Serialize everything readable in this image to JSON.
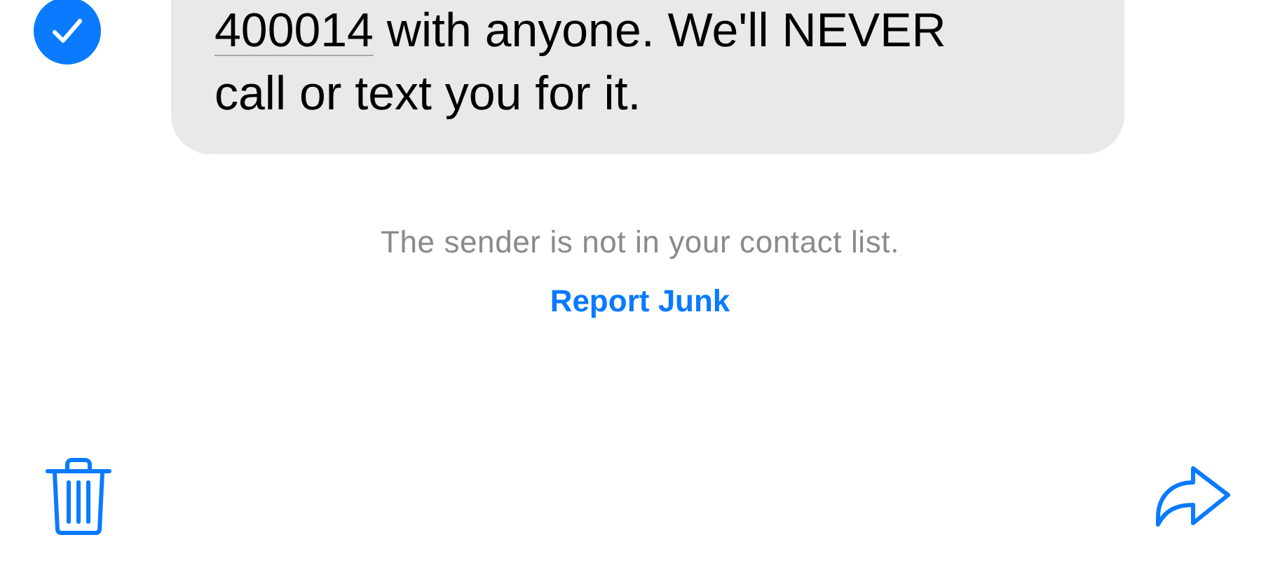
{
  "message": {
    "selected": true,
    "lines": [
      {
        "link": "400014",
        "text": " with anyone. We'll NEVER"
      },
      {
        "text": "call or text you for it."
      }
    ]
  },
  "notice": "The sender is not in your contact list.",
  "report_link": "Report Junk",
  "toolbar": {
    "buttons": [
      {
        "kind": "delete"
      },
      {
        "kind": "forward"
      }
    ]
  }
}
